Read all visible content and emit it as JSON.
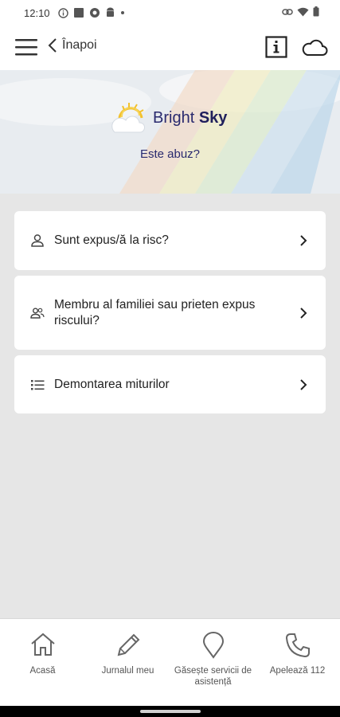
{
  "status_bar": {
    "time": "12:10",
    "left_icons": [
      "info-circle-icon",
      "square-icon",
      "record-icon",
      "android-icon",
      "dot-icon"
    ],
    "right_icons": [
      "link-icon",
      "wifi-icon",
      "battery-icon"
    ]
  },
  "app_bar": {
    "back_label": "Înapoi",
    "icons": [
      "hamburger-menu-icon",
      "chevron-left-icon",
      "info-box-icon",
      "cloud-icon"
    ]
  },
  "banner": {
    "logo_text_light": "Bright",
    "logo_text_bold": "Sky",
    "title": "Este abuz?"
  },
  "cards": [
    {
      "label": "Sunt expus/ă la risc?",
      "icon": "person-icon"
    },
    {
      "label": "Membru al familiei sau prieten expus riscului?",
      "icon": "people-icon"
    },
    {
      "label": "Demontarea miturilor",
      "icon": "list-icon"
    }
  ],
  "bottom_nav": [
    {
      "label": "Acasă",
      "icon": "home-icon"
    },
    {
      "label": "Jurnalul meu",
      "icon": "pencil-icon"
    },
    {
      "label": "Găsește servicii de asistență",
      "icon": "location-pin-icon"
    },
    {
      "label": "Apelează 112",
      "icon": "phone-icon"
    }
  ],
  "colors": {
    "background": "#e6e6e6",
    "brand_text": "#2a2a6e",
    "card": "#ffffff"
  }
}
